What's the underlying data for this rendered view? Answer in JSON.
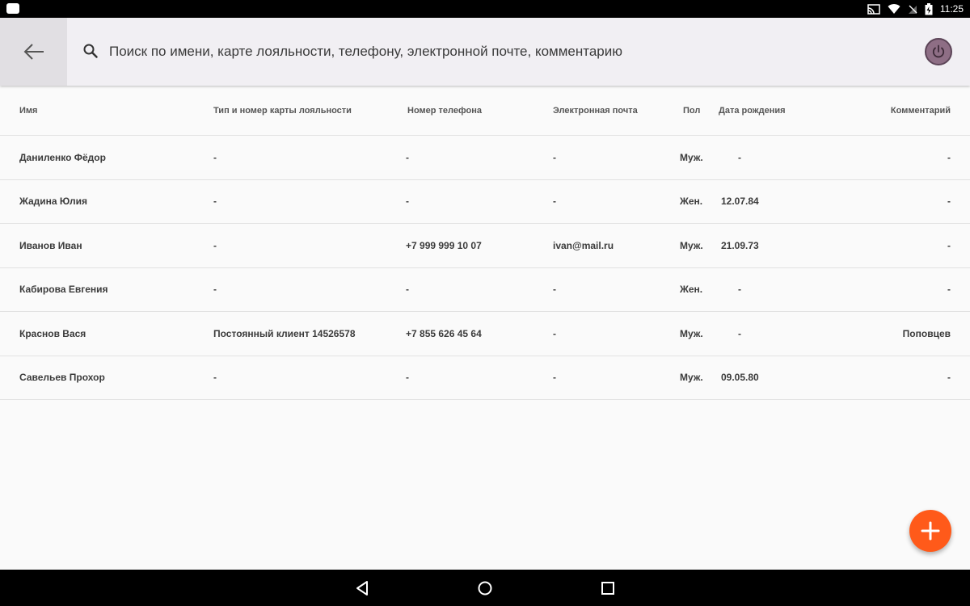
{
  "status_bar": {
    "time": "11:25",
    "icons": [
      "cast-icon",
      "wifi-icon",
      "signal-off-icon",
      "battery-charging-icon"
    ]
  },
  "app_bar": {
    "back_icon": "arrow-left-icon",
    "search_icon": "search-icon",
    "search_placeholder": "Поиск по имени, карте лояльности, телефону, электронной почте, комментарию",
    "power_icon": "power-icon"
  },
  "table": {
    "headers": {
      "name": "Имя",
      "card": "Тип и номер карты лояльности",
      "phone": "Номер телефона",
      "email": "Электронная почта",
      "sex": "Пол",
      "birth": "Дата рождения",
      "comment": "Комментарий"
    },
    "rows": [
      {
        "name": "Даниленко Фёдор",
        "card": "-",
        "phone": "-",
        "email": "-",
        "sex": "Муж.",
        "birth": "-",
        "comment": "-"
      },
      {
        "name": "Жадина Юлия",
        "card": "-",
        "phone": "-",
        "email": "-",
        "sex": "Жен.",
        "birth": "12.07.84",
        "comment": "-"
      },
      {
        "name": "Иванов Иван",
        "card": "-",
        "phone": "+7 999 999 10 07",
        "email": "ivan@mail.ru",
        "sex": "Муж.",
        "birth": "21.09.73",
        "comment": "-"
      },
      {
        "name": "Кабирова Евгения",
        "card": "-",
        "phone": "-",
        "email": "-",
        "sex": "Жен.",
        "birth": "-",
        "comment": "-"
      },
      {
        "name": "Краснов Вася",
        "card": "Постоянный клиент 14526578",
        "phone": "+7 855 626 45 64",
        "email": "-",
        "sex": "Муж.",
        "birth": "-",
        "comment": "Поповцев"
      },
      {
        "name": "Савельев Прохор",
        "card": "-",
        "phone": "-",
        "email": "-",
        "sex": "Муж.",
        "birth": "09.05.80",
        "comment": "-"
      }
    ]
  },
  "fab": {
    "icon": "plus-icon"
  },
  "colors": {
    "accent": "#ff5a1a",
    "app_bar": "#f1eff3",
    "power_button": "#8e6e85"
  },
  "nav_bar": {
    "icons": [
      "back-triangle-icon",
      "home-circle-icon",
      "recents-square-icon"
    ]
  }
}
